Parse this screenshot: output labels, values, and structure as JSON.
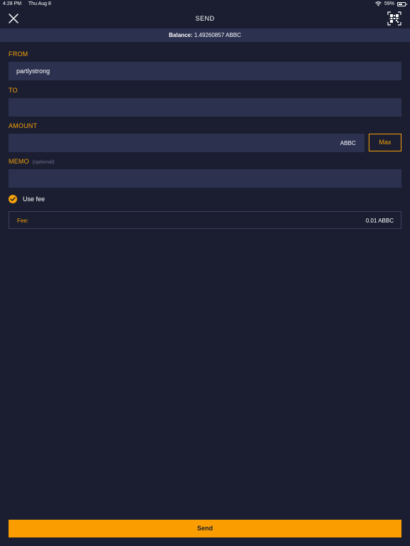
{
  "status_bar": {
    "time": "4:28 PM",
    "date": "Thu Aug 8",
    "battery": "59%",
    "battery_level": 0.59,
    "icons": [
      "wifi-icon",
      "battery-icon"
    ]
  },
  "nav": {
    "title": "SEND",
    "left_icon": "close-icon",
    "right_icon": "qr-scan-icon"
  },
  "balance": {
    "label": "Balance:",
    "value": "1.49260857 ABBC"
  },
  "form": {
    "from_label": "FROM",
    "from_value": "partlystrong",
    "to_label": "TO",
    "to_value": "",
    "amount_label": "AMOUNT",
    "amount_value": "",
    "amount_unit": "ABBC",
    "max_label": "Max",
    "memo_label": "MEMO",
    "memo_hint": "(optional)",
    "memo_value": "",
    "use_fee_label": "Use fee",
    "use_fee_checked": true,
    "fee_label": "Fee:",
    "fee_value": "0.01 ABBC"
  },
  "send_button": "Send",
  "colors": {
    "background": "#1b1e31",
    "field": "#2c3150",
    "accent": "#f5a10a",
    "button": "#fa9d00"
  }
}
